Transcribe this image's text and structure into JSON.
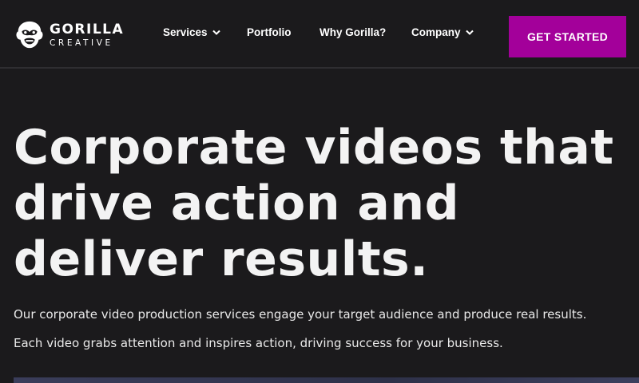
{
  "brand": {
    "name_line1": "GORILLA",
    "name_line2": "CREATIVE",
    "logo_icon": "gorilla-head-icon"
  },
  "nav": {
    "items": [
      {
        "label": "Services",
        "has_dropdown": true
      },
      {
        "label": "Portfolio",
        "has_dropdown": false
      },
      {
        "label": "Why Gorilla?",
        "has_dropdown": false
      },
      {
        "label": "Company",
        "has_dropdown": true
      }
    ],
    "cta_label": "GET STARTED"
  },
  "hero": {
    "headline_lines": [
      "Corporate videos that",
      "drive action and",
      "deliver results."
    ],
    "paragraph_1": "Our corporate video production services engage your target audience and produce real results.",
    "paragraph_2": "Each video grabs attention and inspires action, driving success for your business."
  },
  "colors": {
    "background": "#1b1a1c",
    "accent": "#a3009a",
    "text": "#ffffff"
  }
}
